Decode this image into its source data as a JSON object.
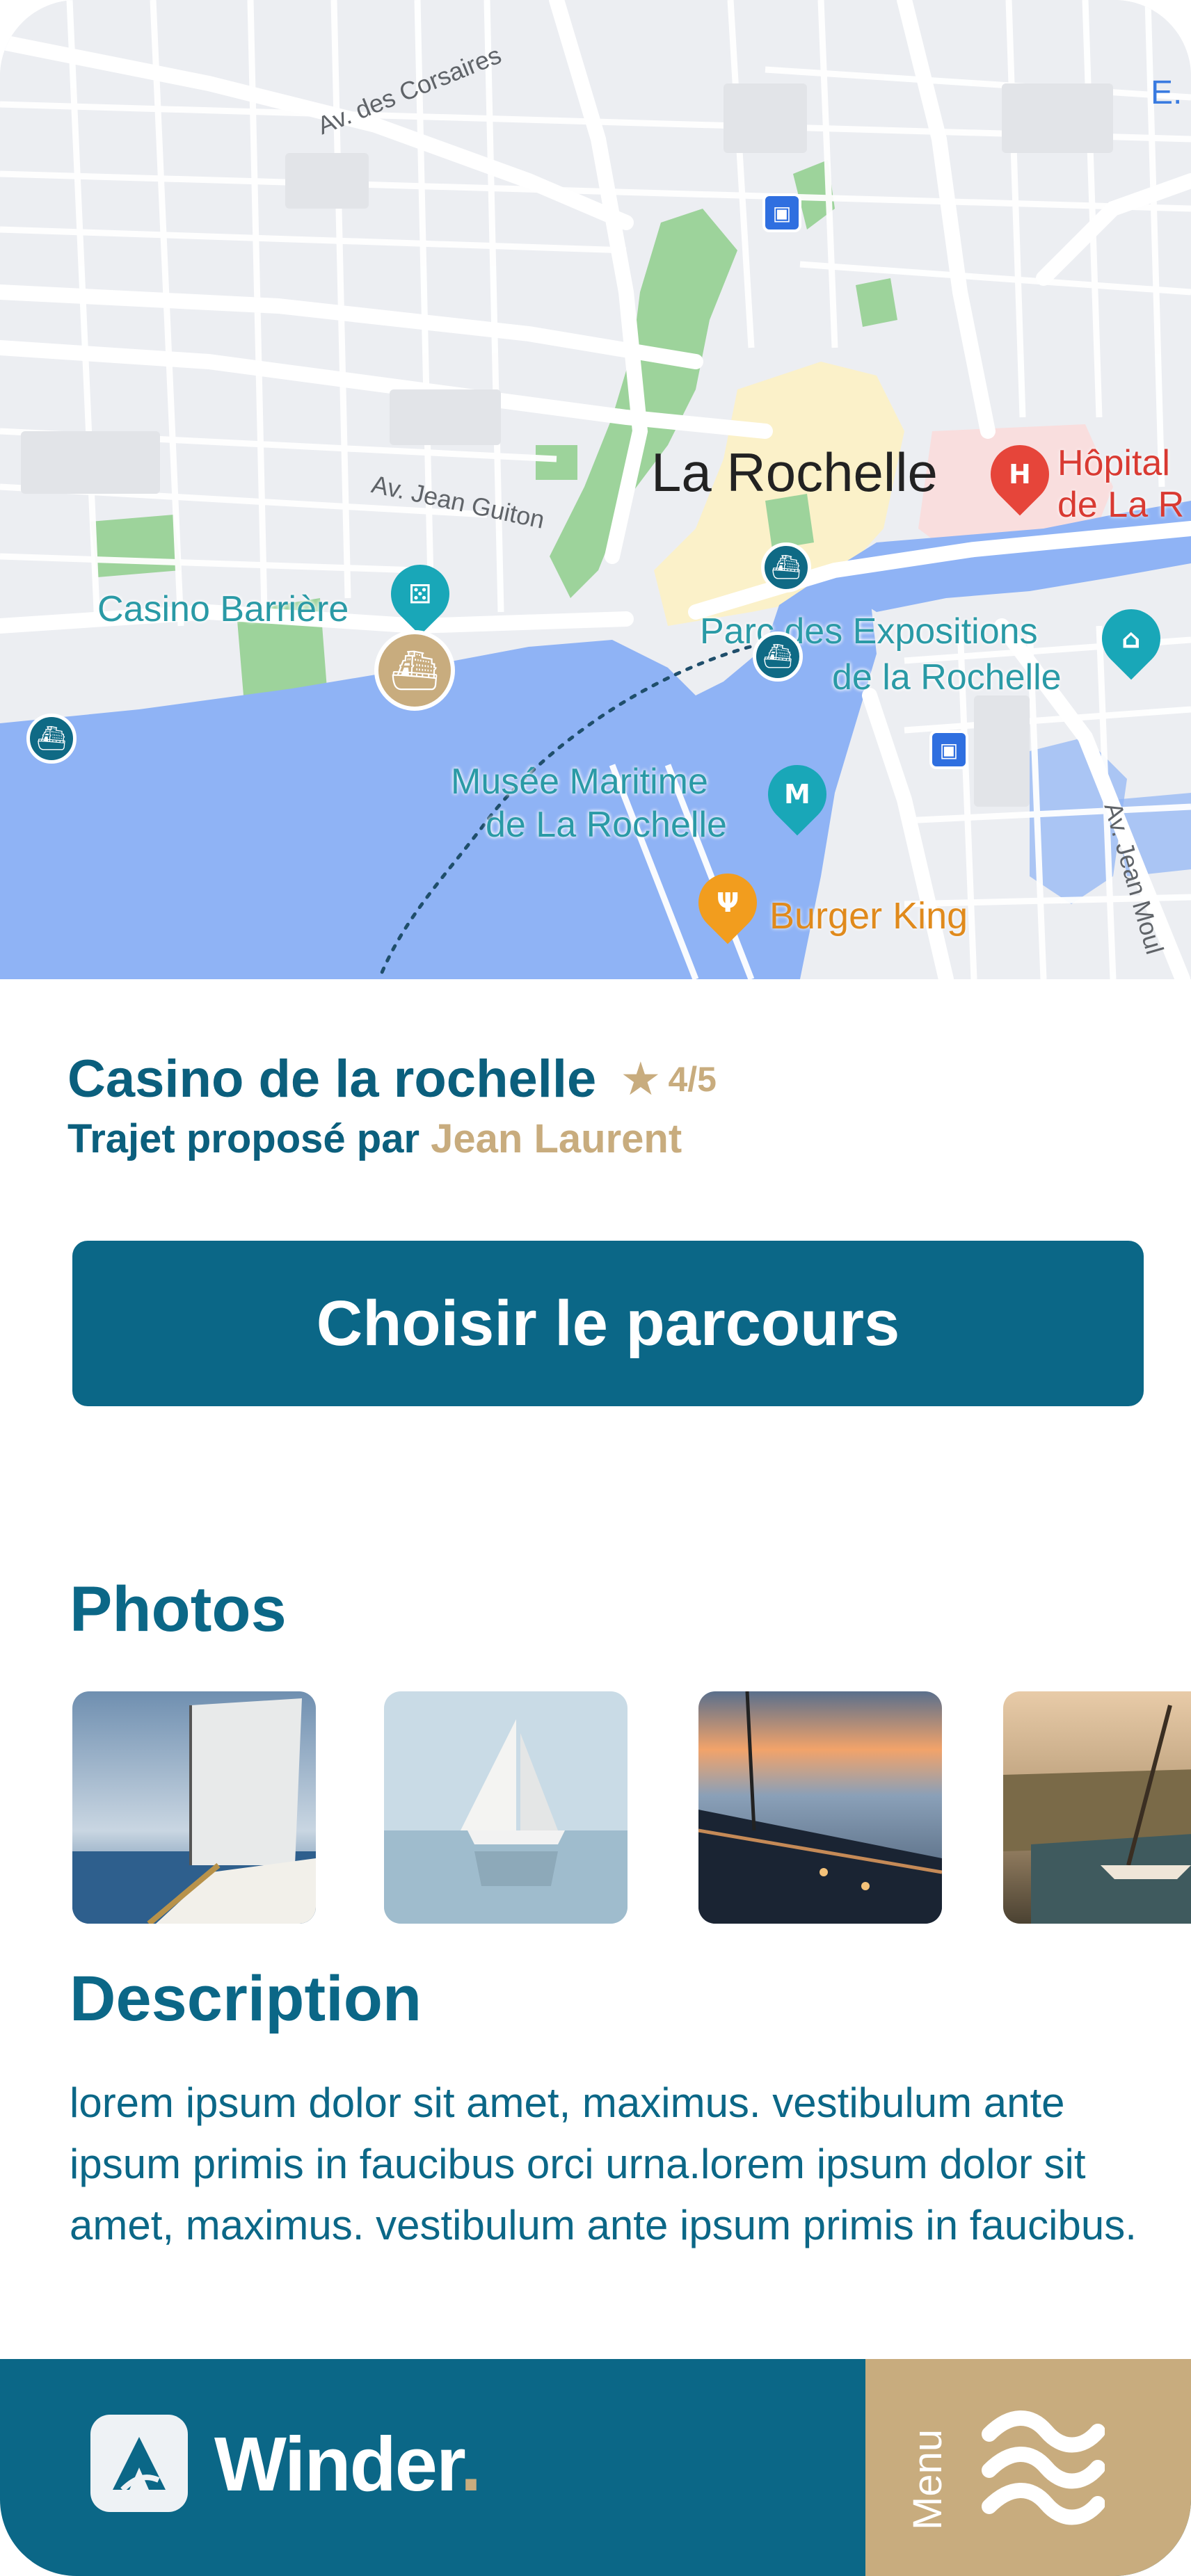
{
  "map": {
    "city_label": "La Rochelle",
    "streets": {
      "corsaires": "Av. des Corsaires",
      "guiton": "Av. Jean Guiton",
      "moulin": "Av. Jean Moul"
    },
    "pois": {
      "casino": "Casino Barrière",
      "hopital_1": "Hôpital",
      "hopital_2": "de La R",
      "expo_1": "Parc des Expositions",
      "expo_2": "de la Rochelle",
      "musee_1": "Musée Maritime",
      "musee_2": "de La Rochelle",
      "burger": "Burger King",
      "edge": "E."
    },
    "icons": [
      "ferry-icon",
      "train-icon",
      "hospital-icon",
      "museum-icon",
      "restaurant-icon",
      "casino-icon"
    ]
  },
  "route": {
    "title": "Casino de la rochelle",
    "rating": "4/5",
    "proposed_prefix": "Trajet proposé par",
    "author": "Jean Laurent"
  },
  "cta": {
    "label": "Choisir le parcours"
  },
  "photos": {
    "title": "Photos",
    "items": [
      "sailboat-deck-photo",
      "sailboat-sea-photo",
      "yacht-sunset-photo",
      "felucca-river-photo"
    ]
  },
  "description": {
    "title": "Description",
    "text": "lorem ipsum dolor sit amet, maximus. vestibulum ante ipsum primis in faucibus orci urna.lorem ipsum dolor sit amet, maximus. vestibulum ante ipsum primis in faucibus."
  },
  "bottom_bar": {
    "brand": "Winder",
    "brand_dot": ".",
    "menu_label": "Menu"
  },
  "colors": {
    "primary": "#0b6787",
    "accent": "#c8ac7e",
    "water": "#8fb3f5"
  }
}
